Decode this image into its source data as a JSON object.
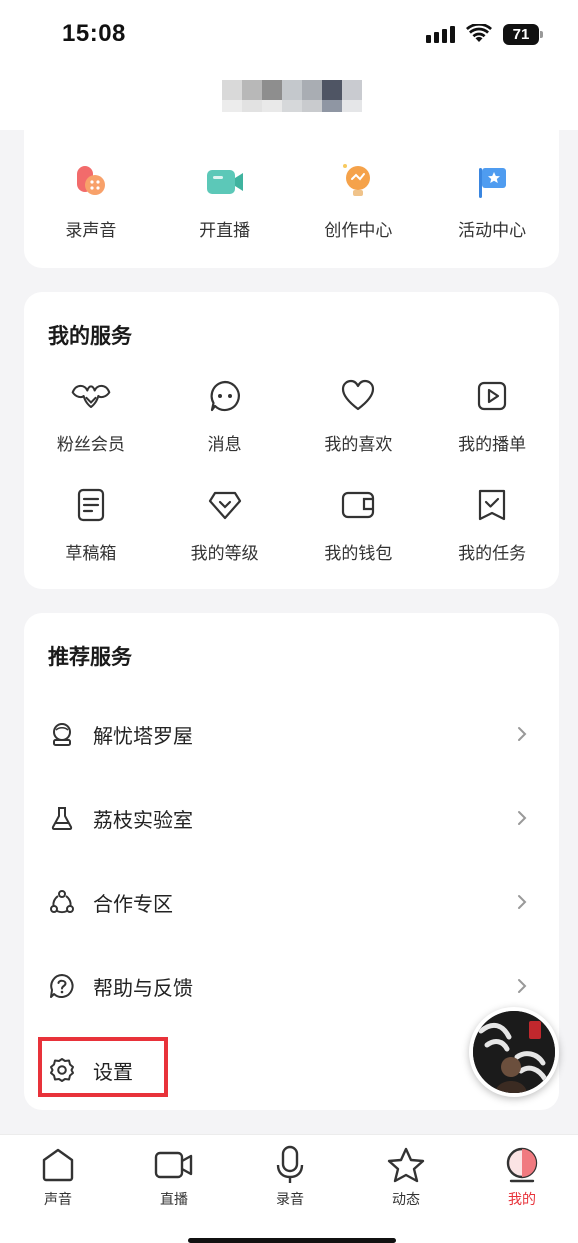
{
  "status_bar": {
    "time": "15:08",
    "battery": "71"
  },
  "quick_actions": [
    {
      "label": "录声音",
      "icon": "record-voice-icon"
    },
    {
      "label": "开直播",
      "icon": "live-camera-icon"
    },
    {
      "label": "创作中心",
      "icon": "creator-bulb-icon"
    },
    {
      "label": "活动中心",
      "icon": "activity-flag-icon"
    }
  ],
  "my_services": {
    "title": "我的服务",
    "items": [
      {
        "label": "粉丝会员",
        "icon": "fan-club-icon"
      },
      {
        "label": "消息",
        "icon": "message-icon"
      },
      {
        "label": "我的喜欢",
        "icon": "heart-icon"
      },
      {
        "label": "我的播单",
        "icon": "playlist-icon"
      },
      {
        "label": "草稿箱",
        "icon": "draft-icon"
      },
      {
        "label": "我的等级",
        "icon": "level-diamond-icon"
      },
      {
        "label": "我的钱包",
        "icon": "wallet-icon"
      },
      {
        "label": "我的任务",
        "icon": "task-icon"
      }
    ]
  },
  "recommended": {
    "title": "推荐服务",
    "items": [
      {
        "label": "解忧塔罗屋",
        "icon": "tarot-icon"
      },
      {
        "label": "荔枝实验室",
        "icon": "flask-icon"
      },
      {
        "label": "合作专区",
        "icon": "cooperation-icon"
      },
      {
        "label": "帮助与反馈",
        "icon": "help-icon"
      },
      {
        "label": "设置",
        "icon": "gear-icon"
      }
    ]
  },
  "tabbar": [
    {
      "label": "声音",
      "icon": "home-icon",
      "active": false
    },
    {
      "label": "直播",
      "icon": "video-camera-icon",
      "active": false
    },
    {
      "label": "录音",
      "icon": "microphone-icon",
      "active": false
    },
    {
      "label": "动态",
      "icon": "star-icon",
      "active": false
    },
    {
      "label": "我的",
      "icon": "profile-icon",
      "active": true
    }
  ],
  "colors": {
    "accent": "#e8323a",
    "background": "#f4f4f6",
    "card": "#ffffff"
  }
}
